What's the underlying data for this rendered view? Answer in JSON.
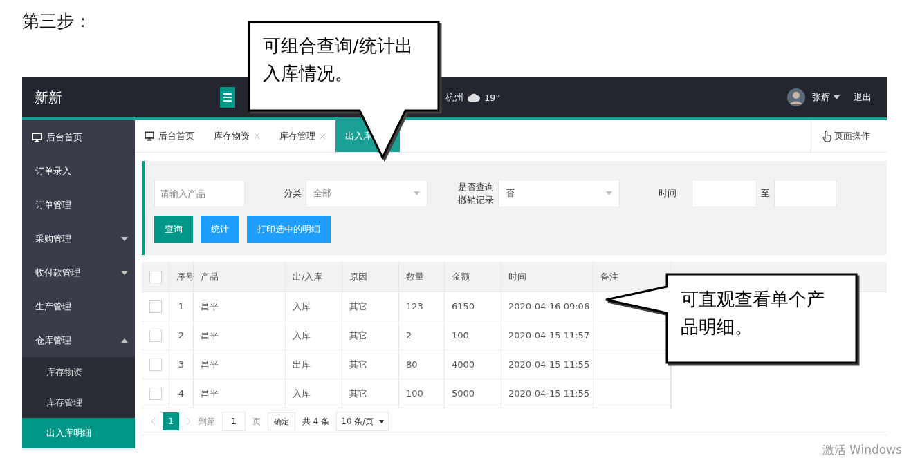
{
  "heading": "第三步：",
  "header": {
    "logo": "新新",
    "weather": {
      "city": "杭州",
      "temp": "19°"
    },
    "user": {
      "name": "张辉"
    },
    "logout": "退出"
  },
  "sidebar": {
    "items": [
      {
        "label": "后台首页",
        "kind": "home",
        "selected": false
      },
      {
        "label": "订单录入",
        "kind": "item",
        "selected": false
      },
      {
        "label": "订单管理",
        "kind": "item",
        "selected": false
      },
      {
        "label": "采购管理",
        "kind": "group",
        "expanded": false,
        "selected": false
      },
      {
        "label": "收付款管理",
        "kind": "group",
        "expanded": false,
        "selected": false
      },
      {
        "label": "生产管理",
        "kind": "item",
        "selected": false
      },
      {
        "label": "仓库管理",
        "kind": "group",
        "expanded": true,
        "selected": false,
        "children": [
          {
            "label": "库存物资",
            "selected": false
          },
          {
            "label": "库存管理",
            "selected": false
          },
          {
            "label": "出入库明细",
            "selected": true
          }
        ]
      }
    ]
  },
  "tabs": [
    {
      "label": "后台首页",
      "kind": "home",
      "closable": false,
      "selected": false
    },
    {
      "label": "库存物资",
      "kind": "page",
      "closable": true,
      "selected": false
    },
    {
      "label": "库存管理",
      "kind": "page",
      "closable": true,
      "selected": false
    },
    {
      "label": "出入库",
      "kind": "page",
      "closable": false,
      "selected": true
    }
  ],
  "page_ops": "页面操作",
  "filters": {
    "product": {
      "placeholder": "请输入产品"
    },
    "category": {
      "label": "分类",
      "value": "全部"
    },
    "revoked": {
      "label": "是否查询撤销记录",
      "value": "否"
    },
    "time": {
      "label": "时间",
      "separator": "至"
    }
  },
  "buttons": [
    {
      "label": "查询",
      "kind": "primary"
    },
    {
      "label": "统计",
      "kind": "normal"
    },
    {
      "label": "打印选中的明细",
      "kind": "normal"
    }
  ],
  "table": {
    "all_checked": false,
    "columns": [
      "序号",
      "产品",
      "出/入库",
      "原因",
      "数量",
      "金额",
      "时间",
      "备注"
    ],
    "rows": [
      {
        "checked": false,
        "cells": [
          "1",
          "昌平",
          "入库",
          "其它",
          "123",
          "6150",
          "2020-04-16 09:06",
          ""
        ]
      },
      {
        "checked": false,
        "cells": [
          "2",
          "昌平",
          "入库",
          "其它",
          "2",
          "100",
          "2020-04-15 11:57",
          ""
        ]
      },
      {
        "checked": false,
        "cells": [
          "3",
          "昌平",
          "出库",
          "其它",
          "80",
          "4000",
          "2020-04-15 11:55",
          ""
        ]
      },
      {
        "checked": false,
        "cells": [
          "4",
          "昌平",
          "入库",
          "其它",
          "100",
          "5000",
          "2020-04-15 11:55",
          ""
        ]
      }
    ]
  },
  "pagination": {
    "pages": [
      {
        "label": "1",
        "selected": true
      }
    ],
    "goto_label": "到第",
    "goto_value": "1",
    "page_unit": "页",
    "confirm": "确定",
    "total": "共 4 条",
    "page_size": "10 条/页"
  },
  "callouts": [
    {
      "text": "可组合查询/统计出入库情况。"
    },
    {
      "text": "可直观查看单个产品明细。"
    }
  ],
  "system_notice": "激活 Windows"
}
